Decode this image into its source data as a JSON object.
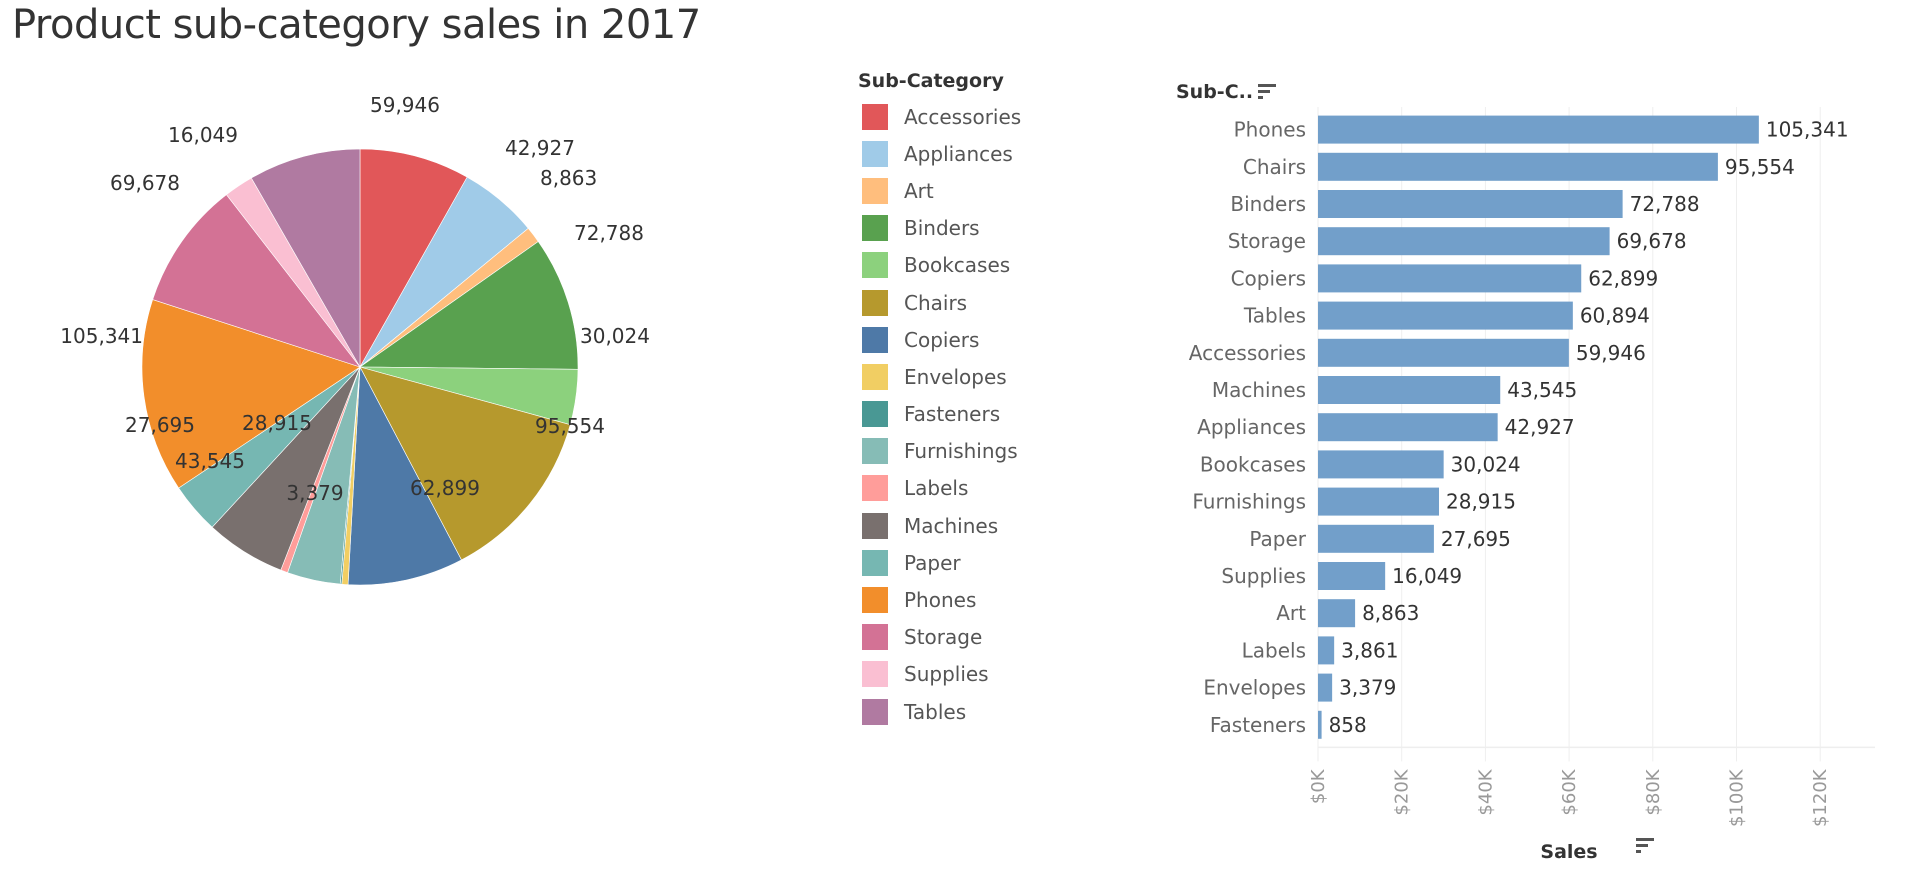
{
  "title": "Product sub-category sales in  2017",
  "chart_data": [
    {
      "type": "pie",
      "title": "Product sub-category sales in  2017",
      "legend_title": "Sub-Category",
      "legend_placement": "right",
      "start_angle_note": "clockwise from 12 o'clock in legend order",
      "slices": [
        {
          "label": "Accessories",
          "value": 59946,
          "color": "#E15759",
          "display": "59,946"
        },
        {
          "label": "Appliances",
          "value": 42927,
          "color": "#A0CBE8",
          "display": "42,927"
        },
        {
          "label": "Art",
          "value": 8863,
          "color": "#FFBE7D",
          "display": "8,863"
        },
        {
          "label": "Binders",
          "value": 72788,
          "color": "#59A14F",
          "display": "72,788"
        },
        {
          "label": "Bookcases",
          "value": 30024,
          "color": "#8CD17D",
          "display": "30,024"
        },
        {
          "label": "Chairs",
          "value": 95554,
          "color": "#B6992D",
          "display": "95,554"
        },
        {
          "label": "Copiers",
          "value": 62899,
          "color": "#4E79A7",
          "display": "62,899"
        },
        {
          "label": "Envelopes",
          "value": 3379,
          "color": "#F1CE63",
          "display": ""
        },
        {
          "label": "Fasteners",
          "value": 858,
          "color": "#499894",
          "display": ""
        },
        {
          "label": "Furnishings",
          "value": 28915,
          "color": "#86BCB6",
          "display": "3,379"
        },
        {
          "label": "Labels",
          "value": 3861,
          "color": "#FF9D9A",
          "display": ""
        },
        {
          "label": "Machines",
          "value": 43545,
          "color": "#79706E",
          "display": "43,545"
        },
        {
          "label": "Paper",
          "value": 27695,
          "color": "#76B7B2",
          "display": "27,695"
        },
        {
          "label": "Phones",
          "value": 105341,
          "color": "#F28E2B",
          "display": "105,341"
        },
        {
          "label": "Storage",
          "value": 69678,
          "color": "#D37295",
          "display": "69,678"
        },
        {
          "label": "Supplies",
          "value": 16049,
          "color": "#FABFD2",
          "display": "16,049"
        },
        {
          "label": "Tables",
          "value": 60894,
          "color": "#B07AA1",
          "display": ""
        }
      ],
      "inner_label": "28,915"
    },
    {
      "type": "bar",
      "orientation": "horizontal",
      "row_header": "Sub-C..",
      "xlabel": "Sales",
      "ylabel": "Sub-Category",
      "xlim": [
        0,
        130000
      ],
      "x_ticks": [
        {
          "value": 0,
          "label": "$0K"
        },
        {
          "value": 20000,
          "label": "$20K"
        },
        {
          "value": 40000,
          "label": "$40K"
        },
        {
          "value": 60000,
          "label": "$60K"
        },
        {
          "value": 80000,
          "label": "$80K"
        },
        {
          "value": 100000,
          "label": "$100K"
        },
        {
          "value": 120000,
          "label": "$120K"
        }
      ],
      "grid": true,
      "bar_color": "#729FCA",
      "categories": [
        "Phones",
        "Chairs",
        "Binders",
        "Storage",
        "Copiers",
        "Tables",
        "Accessories",
        "Machines",
        "Appliances",
        "Bookcases",
        "Furnishings",
        "Paper",
        "Supplies",
        "Art",
        "Labels",
        "Envelopes",
        "Fasteners"
      ],
      "values": [
        105341,
        95554,
        72788,
        69678,
        62899,
        60894,
        59946,
        43545,
        42927,
        30024,
        28915,
        27695,
        16049,
        8863,
        3861,
        3379,
        858
      ],
      "value_labels": [
        "105,341",
        "95,554",
        "72,788",
        "69,678",
        "62,899",
        "60,894",
        "59,946",
        "43,545",
        "42,927",
        "30,024",
        "28,915",
        "27,695",
        "16,049",
        "8,863",
        "3,861",
        "3,379",
        "858"
      ]
    }
  ]
}
